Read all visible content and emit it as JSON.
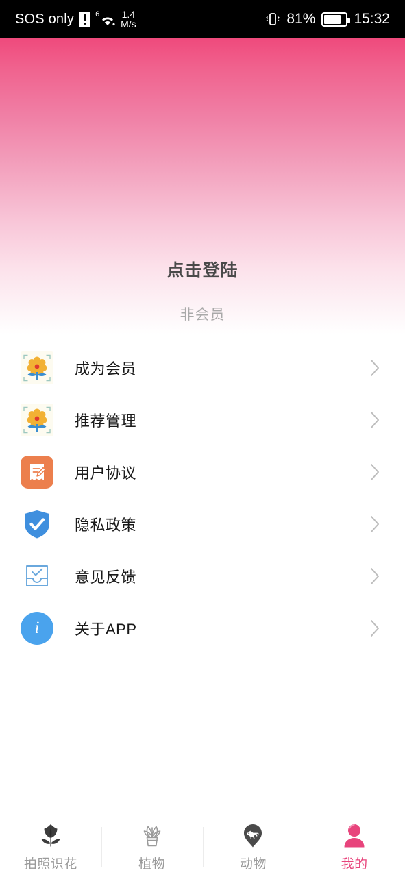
{
  "statusbar": {
    "carrier": "SOS only",
    "alert_icon": "alert-exclamation-icon",
    "network_gen": "6",
    "wifi_icon": "wifi-icon",
    "speed_value": "1.4",
    "speed_unit": "M/s",
    "vibrate_icon": "vibrate-icon",
    "battery_percent": "81%",
    "battery_icon": "battery-icon",
    "clock": "15:32"
  },
  "header": {
    "login_title": "点击登陆",
    "member_status": "非会员",
    "gradient_top_color": "#ef4a7c",
    "gradient_bottom_color": "#ffffff"
  },
  "menu": {
    "items": [
      {
        "label": "成为会员",
        "icon": "flower-photo-icon",
        "arrow": "chevron-right-icon"
      },
      {
        "label": "推荐管理",
        "icon": "flower-photo-icon",
        "arrow": "chevron-right-icon"
      },
      {
        "label": "用户协议",
        "icon": "document-pen-icon",
        "arrow": "chevron-right-icon"
      },
      {
        "label": "隐私政策",
        "icon": "shield-check-icon",
        "arrow": "chevron-right-icon"
      },
      {
        "label": "意见反馈",
        "icon": "inbox-check-icon",
        "arrow": "chevron-right-icon"
      },
      {
        "label": "关于APP",
        "icon": "info-circle-icon",
        "arrow": "chevron-right-icon"
      }
    ]
  },
  "tabbar": {
    "active_color": "#e8447c",
    "inactive_color": "#9a9a9a",
    "tabs": [
      {
        "label": "拍照识花",
        "icon": "tulip-icon",
        "active": false
      },
      {
        "label": "植物",
        "icon": "potted-plant-icon",
        "active": false
      },
      {
        "label": "动物",
        "icon": "animal-pin-icon",
        "active": false
      },
      {
        "label": "我的",
        "icon": "person-icon",
        "active": true
      }
    ]
  }
}
